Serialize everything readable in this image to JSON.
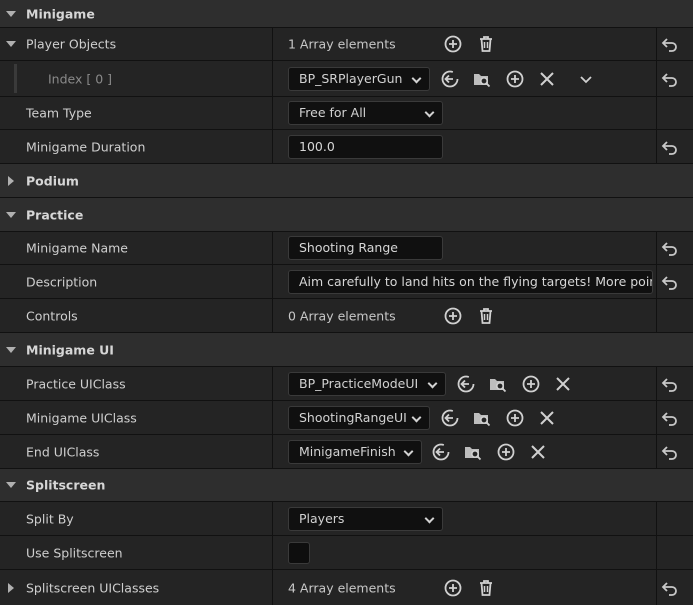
{
  "sections": {
    "minigame": "Minigame",
    "podium": "Podium",
    "practice": "Practice",
    "minigame_ui": "Minigame UI",
    "splitscreen": "Splitscreen"
  },
  "minigame": {
    "player_objects_label": "Player Objects",
    "player_objects_count": "1 Array elements",
    "index_label": "Index [ 0 ]",
    "index_value": "BP_SRPlayerGun",
    "team_type_label": "Team Type",
    "team_type_value": "Free for All",
    "duration_label": "Minigame Duration",
    "duration_value": "100.0"
  },
  "practice": {
    "name_label": "Minigame Name",
    "name_value": "Shooting Range",
    "description_label": "Description",
    "description_value": "Aim carefully to land hits on the flying targets! More points a",
    "controls_label": "Controls",
    "controls_count": "0 Array elements"
  },
  "minigame_ui": {
    "practice_label": "Practice UIClass",
    "practice_value": "BP_PracticeModeUI",
    "minigame_label": "Minigame UIClass",
    "minigame_value": "ShootingRangeUI",
    "end_label": "End UIClass",
    "end_value": "MinigameFinish"
  },
  "splitscreen": {
    "split_by_label": "Split By",
    "split_by_value": "Players",
    "use_label": "Use Splitscreen",
    "use_checked": false,
    "uiclasses_label": "Splitscreen UIClasses",
    "uiclasses_count": "4 Array elements"
  },
  "icons": {
    "expand": "triangle-down-icon",
    "collapse": "triangle-right-icon",
    "add": "plus-circle-icon",
    "delete": "trash-icon",
    "reset": "reset-arrow-icon",
    "use": "arrow-left-circle-icon",
    "browse": "folder-search-icon",
    "clear": "x-icon",
    "more": "chevron-down-icon"
  },
  "colors": {
    "section_bg": "#2e2e2e",
    "row_bg": "#242424",
    "field_bg": "#101010",
    "text": "#c8c8c8"
  }
}
